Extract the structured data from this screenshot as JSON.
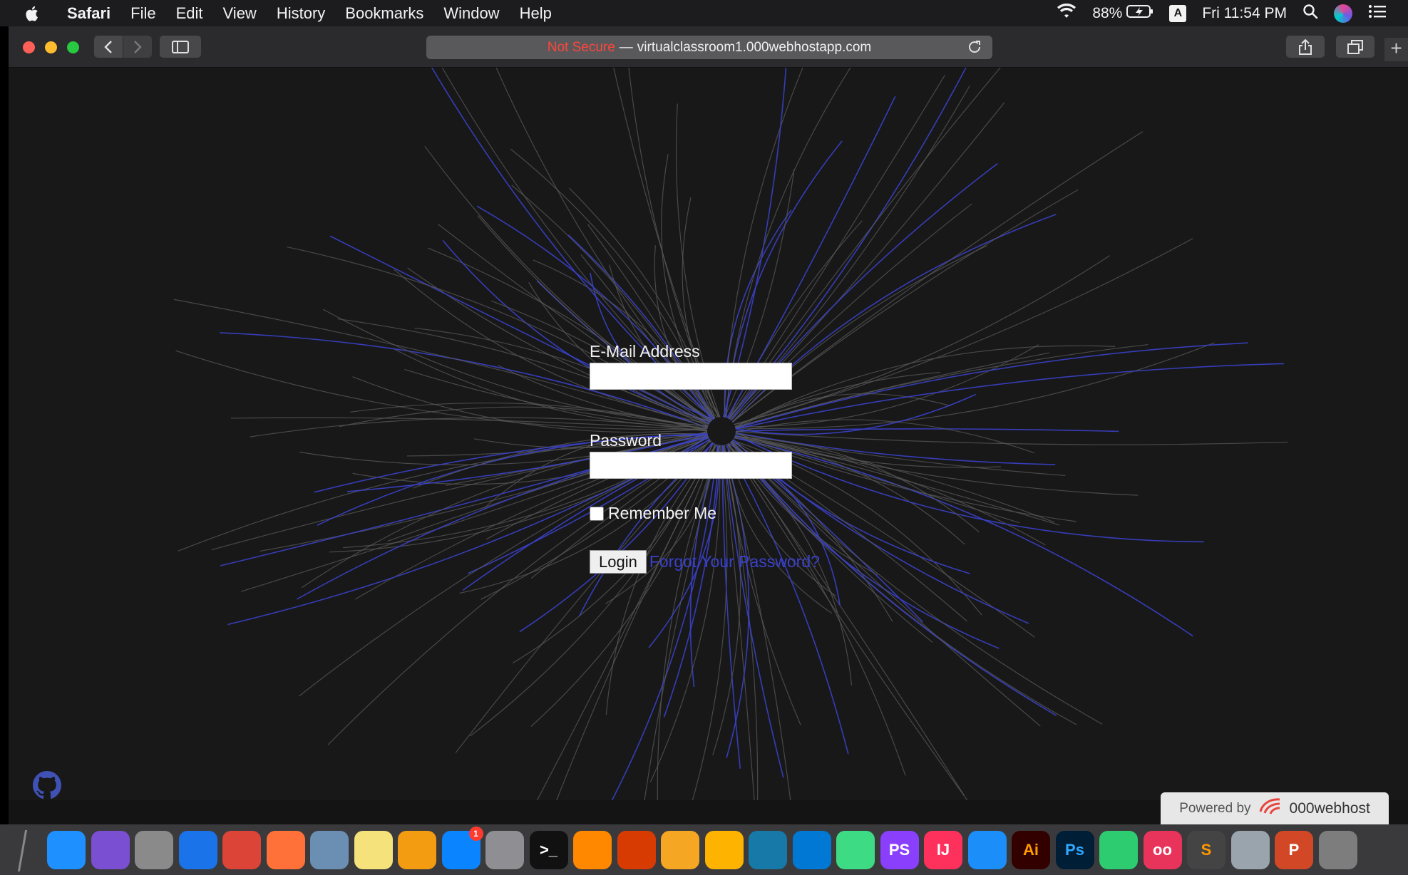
{
  "menubar": {
    "apple_icon": "apple-icon",
    "menus": [
      "Safari",
      "File",
      "Edit",
      "View",
      "History",
      "Bookmarks",
      "Window",
      "Help"
    ],
    "battery": "88%",
    "input_source": "A",
    "clock": "Fri 11:54 PM"
  },
  "toolbar": {
    "not_secure": "Not Secure",
    "separator": "—",
    "url": "virtualclassroom1.000webhostapp.com",
    "new_tab": "+"
  },
  "login": {
    "email_label": "E-Mail Address",
    "email_value": "",
    "password_label": "Password",
    "password_value": "",
    "remember_label": "Remember Me",
    "login_button": "Login",
    "forgot_link": "Forgot Your Password?"
  },
  "footer": {
    "powered_by": "Powered by",
    "host_brand": "000webhost"
  },
  "colors": {
    "page_bg": "#181818",
    "line_gray": "#5a5a5a",
    "line_blue": "#3a41c9",
    "link": "#3a41c9"
  },
  "dock": {
    "items": [
      {
        "name": "finder-icon",
        "glyph": "",
        "color": "#1e90ff"
      },
      {
        "name": "siri-icon",
        "glyph": "",
        "color": "#7a4fd1"
      },
      {
        "name": "launchpad-icon",
        "glyph": "",
        "color": "#8a8a8a"
      },
      {
        "name": "safari-icon",
        "glyph": "",
        "color": "#1a73e8"
      },
      {
        "name": "chrome-icon",
        "glyph": "",
        "color": "#db4437"
      },
      {
        "name": "firefox-icon",
        "glyph": "",
        "color": "#ff7139"
      },
      {
        "name": "preview-icon",
        "glyph": "",
        "color": "#6b8fb3"
      },
      {
        "name": "notes-icon",
        "glyph": "",
        "color": "#f5e27a"
      },
      {
        "name": "photos-icon",
        "glyph": "",
        "color": "#f39c12"
      },
      {
        "name": "app-store-icon",
        "glyph": "",
        "color": "#0a84ff",
        "badge": "1"
      },
      {
        "name": "system-preferences-icon",
        "glyph": "",
        "color": "#8e8e93"
      },
      {
        "name": "terminal-icon",
        "glyph": ">_",
        "color": "#111111"
      },
      {
        "name": "vlc-icon",
        "glyph": "",
        "color": "#ff8800"
      },
      {
        "name": "office-icon",
        "glyph": "",
        "color": "#d83b01"
      },
      {
        "name": "tableplus-icon",
        "glyph": "",
        "color": "#f5a623"
      },
      {
        "name": "sketch-icon",
        "glyph": "",
        "color": "#fdb300"
      },
      {
        "name": "wireshark-icon",
        "glyph": "",
        "color": "#1679a7"
      },
      {
        "name": "vscode-icon",
        "glyph": "",
        "color": "#0078d4"
      },
      {
        "name": "android-studio-icon",
        "glyph": "",
        "color": "#3ddc84"
      },
      {
        "name": "phpstorm-icon",
        "glyph": "PS",
        "color": "#8a3ffc"
      },
      {
        "name": "intellij-icon",
        "glyph": "IJ",
        "color": "#fe315d"
      },
      {
        "name": "xcode-icon",
        "glyph": "",
        "color": "#1c8ef9"
      },
      {
        "name": "illustrator-icon",
        "glyph": "Ai",
        "color": "#330000"
      },
      {
        "name": "photoshop-icon",
        "glyph": "Ps",
        "color": "#001e36"
      },
      {
        "name": "android-file-transfer-icon",
        "glyph": "",
        "color": "#2ecc71"
      },
      {
        "name": "flickr-icon",
        "glyph": "oo",
        "color": "#e8335a"
      },
      {
        "name": "sublime-text-icon",
        "glyph": "S",
        "color": "#444444"
      },
      {
        "name": "archive-utility-icon",
        "glyph": "",
        "color": "#9aa4ad"
      },
      {
        "name": "powerpoint-icon",
        "glyph": "P",
        "color": "#d24726"
      },
      {
        "name": "trash-icon",
        "glyph": "",
        "color": "#7d7d7d"
      }
    ]
  }
}
